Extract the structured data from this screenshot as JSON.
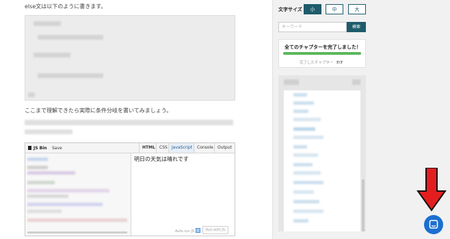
{
  "article": {
    "intro": "else文は以下のように書きます。",
    "paragraph": "ここまで理解できたら実際に条件分岐を書いてみましょう。"
  },
  "jsbin": {
    "logo": "JS Bin",
    "save": "Save",
    "tabs": [
      "HTML",
      "CSS",
      "JavaScript",
      "Console",
      "Output"
    ],
    "active_tab": "JavaScript",
    "output_text": "明日の天気は晴れです",
    "auto_run": "Auto-run JS",
    "run_button": "Run with JS"
  },
  "sidebar": {
    "font_size_label": "文字サイズ",
    "font_sizes": [
      "小",
      "中",
      "大"
    ],
    "font_size_selected": "小",
    "search_placeholder": "キーワード",
    "search_button": "検索",
    "complete_title": "全てのチャプターを完了しました！",
    "progress_fraction": 1.0,
    "completed_label": "完了したチャプター",
    "completed_count": "7/7"
  },
  "colors": {
    "accent": "#1e5b6b",
    "progress": "#5bb85b",
    "chat": "#1c6fd0",
    "arrow": "#e41e1e"
  },
  "icons": {
    "chat": "chat-bubble-icon",
    "arrow": "arrow-down-icon"
  }
}
